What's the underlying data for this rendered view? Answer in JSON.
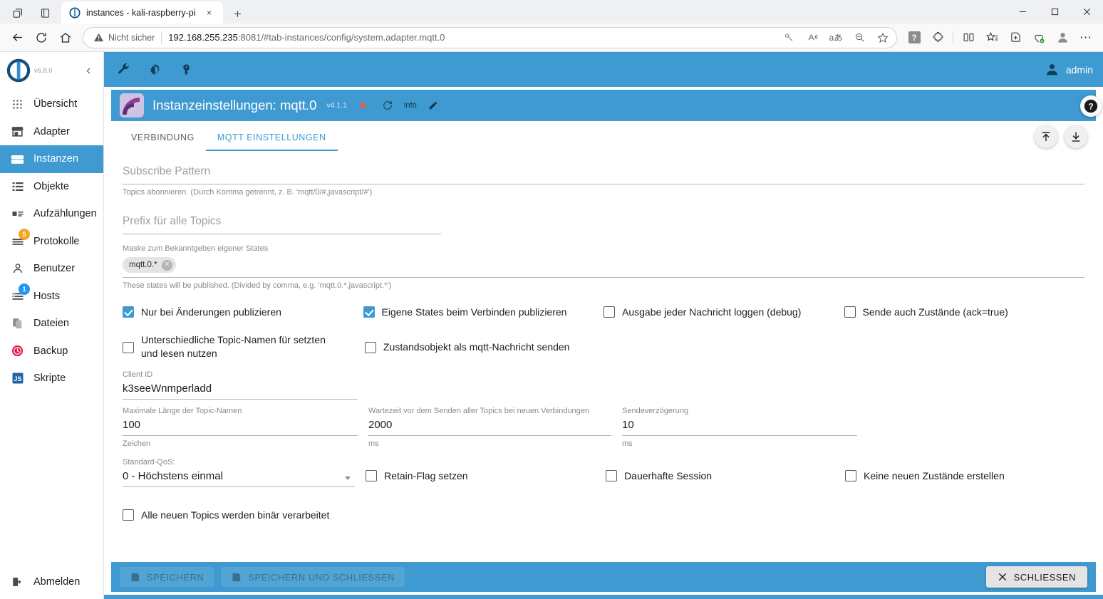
{
  "browser": {
    "tab": {
      "title": "instances - kali-raspberry-pi",
      "close_label": "×"
    },
    "newtab_label": "+",
    "window_controls": {
      "minimize": "—",
      "maximize": "□",
      "close": "✕"
    },
    "nav": {
      "back": "back-arrow",
      "reload": "reload",
      "home": "home"
    },
    "address": {
      "security_label": "Nicht sicher",
      "url_host": "192.168.255.235",
      "url_rest": ":8081/#tab-instances/config/system.adapter.mqtt.0"
    },
    "toolbar_icons": [
      "key-icon",
      "read-aloud-icon",
      "translate-icon",
      "zoom-out-icon",
      "favorite-icon",
      "help-square-icon",
      "extensions-icon",
      "split-screen-icon",
      "collections-icon",
      "browser-essentials-icon",
      "profile-icon",
      "more-icon"
    ]
  },
  "sidebar": {
    "version": "v6.8.0",
    "collapse_label": "‹",
    "items": [
      {
        "label": "Übersicht",
        "icon": "grid-icon",
        "active": false,
        "badge": null
      },
      {
        "label": "Adapter",
        "icon": "store-icon",
        "active": false,
        "badge": null
      },
      {
        "label": "Instanzen",
        "icon": "instances-icon",
        "active": true,
        "badge": null
      },
      {
        "label": "Objekte",
        "icon": "list-icon",
        "active": false,
        "badge": null
      },
      {
        "label": "Aufzählungen",
        "icon": "enum-icon",
        "active": false,
        "badge": null
      },
      {
        "label": "Protokolle",
        "icon": "logs-icon",
        "active": false,
        "badge": "5",
        "badge_color": "#f5a623"
      },
      {
        "label": "Benutzer",
        "icon": "user-icon",
        "active": false,
        "badge": null
      },
      {
        "label": "Hosts",
        "icon": "hosts-icon",
        "active": false,
        "badge": "1",
        "badge_color": "#2196f3"
      },
      {
        "label": "Dateien",
        "icon": "files-icon",
        "active": false,
        "badge": null
      },
      {
        "label": "Backup",
        "icon": "backup-icon",
        "active": false,
        "badge": null
      },
      {
        "label": "Skripte",
        "icon": "scripts-icon",
        "active": false,
        "badge": null
      }
    ],
    "logout": {
      "label": "Abmelden",
      "icon": "logout-icon"
    }
  },
  "app_header": {
    "icons": [
      "wrench-icon",
      "brightness-icon",
      "key-icon"
    ],
    "user": "admin"
  },
  "dialog": {
    "title": "Instanzeinstellungen: mqtt.0",
    "version": "v4.1.1",
    "icon_actions": [
      "play-icon",
      "refresh-icon"
    ],
    "info_label": "info",
    "edit_icon": "pencil-icon",
    "help_icon": "help-icon",
    "fab_upload": "upload-icon",
    "fab_download": "download-icon",
    "tabs": [
      {
        "label": "VERBINDUNG",
        "active": false
      },
      {
        "label": "MQTT EINSTELLUNGEN",
        "active": true
      }
    ]
  },
  "form": {
    "subscribe_pattern": {
      "placeholder": "Subscribe Pattern",
      "value": "",
      "help": "Topics abonnieren. (Durch Komma getrennt, z. B. 'mqtt/0/#,javascript/#')"
    },
    "prefix": {
      "placeholder": "Prefix für alle Topics",
      "value": ""
    },
    "publish_mask": {
      "label": "Maske zum Bekanntgeben eigener States",
      "chips": [
        {
          "text": "mqtt.0.*",
          "remove": "✕"
        }
      ],
      "help": "These states will be published. (Divided by comma, e.g. 'mqtt.0.*,javascript.*')"
    },
    "checkbox_row_1": [
      {
        "label": "Nur bei Änderungen publizieren",
        "checked": true
      },
      {
        "label": "Eigene States beim Verbinden publizieren",
        "checked": true
      },
      {
        "label": "Ausgabe jeder Nachricht loggen (debug)",
        "checked": false
      },
      {
        "label": "Sende auch Zustände (ack=true)",
        "checked": false
      }
    ],
    "checkbox_row_2": [
      {
        "label": "Unterschiedliche Topic-Namen für setzten und lesen nutzen",
        "checked": false
      },
      {
        "label": "Zustandsobjekt als mqtt-Nachricht senden",
        "checked": false
      }
    ],
    "client_id": {
      "label": "Client ID",
      "value": "k3seeWnmperladd"
    },
    "max_topic_length": {
      "label": "Maximale Länge der Topic-Namen",
      "value": "100",
      "unit": "Zeichen"
    },
    "wait_time": {
      "label": "Wartezeit vor dem Senden aller Topics bei neuen Verbindungen",
      "value": "2000",
      "unit": "ms"
    },
    "send_delay": {
      "label": "Sendeverzögerung",
      "value": "10",
      "unit": "ms"
    },
    "qos": {
      "label": "Standard-QoS:",
      "value": "0 - Höchstens einmal"
    },
    "checkbox_row_3": [
      {
        "label": "Retain-Flag setzen",
        "checked": false
      },
      {
        "label": "Dauerhafte Session",
        "checked": false
      },
      {
        "label": "Keine neuen Zustände erstellen",
        "checked": false
      }
    ],
    "checkbox_row_4": [
      {
        "label": "Alle neuen Topics werden binär verarbeitet",
        "checked": false
      }
    ]
  },
  "footer": {
    "save_label": "SPEICHERN",
    "save_close_label": "SPEICHERN UND SCHLIESSEN",
    "close_label": "SCHLIESSEN"
  },
  "colors": {
    "accent": "#3f9ad1",
    "sidebar_active": "#3f9ad1",
    "badge_amber": "#f5a623",
    "badge_blue": "#2196f3",
    "play_red": "#f4573f"
  }
}
